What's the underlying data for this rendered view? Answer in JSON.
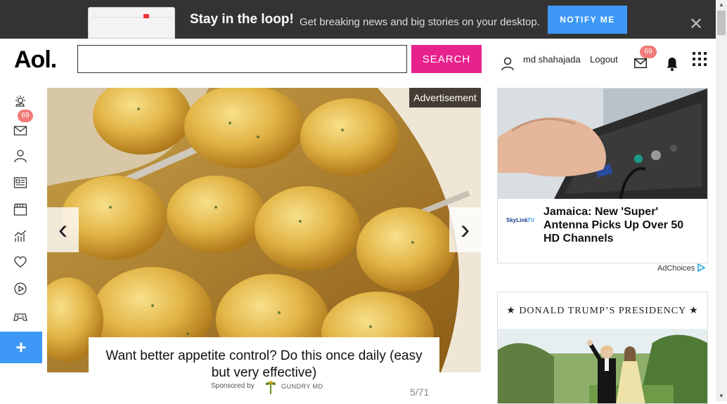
{
  "notify_bar": {
    "title": "Stay in the loop!",
    "subtitle": "Get breaking news and big stories on your desktop.",
    "button": "NOTIFY ME",
    "close_icon": "close-icon"
  },
  "header": {
    "logo": "Aol.",
    "search_value": "",
    "search_button": "SEARCH",
    "user_name": "md shahajada",
    "logout": "Logout",
    "mail_badge": "69"
  },
  "rail": {
    "items": [
      "weather-icon",
      "mail-icon",
      "user-icon",
      "news-icon",
      "video-icon",
      "finance-icon",
      "health-icon",
      "play-icon",
      "games-icon"
    ],
    "mail_badge": "69",
    "plus": "+"
  },
  "slideshow": {
    "ad_label": "Advertisement",
    "prev": "‹",
    "next": "›",
    "caption": "Want better appetite control? Do this once daily (easy but very effective)",
    "sponsored_by": "Sponsored by",
    "sponsor_brand": "GUNDRY MD",
    "counter": "5/71"
  },
  "right_ad": {
    "text": "Jamaica: New 'Super' Antenna Picks Up Over 50 HD Channels",
    "adchoices": "AdChoices"
  },
  "trump_box": {
    "title": "★ DONALD TRUMP’S PRESIDENCY ★"
  },
  "colors": {
    "accent_pink": "#e8228c",
    "accent_blue": "#3d99f5",
    "badge": "#f07b78"
  }
}
